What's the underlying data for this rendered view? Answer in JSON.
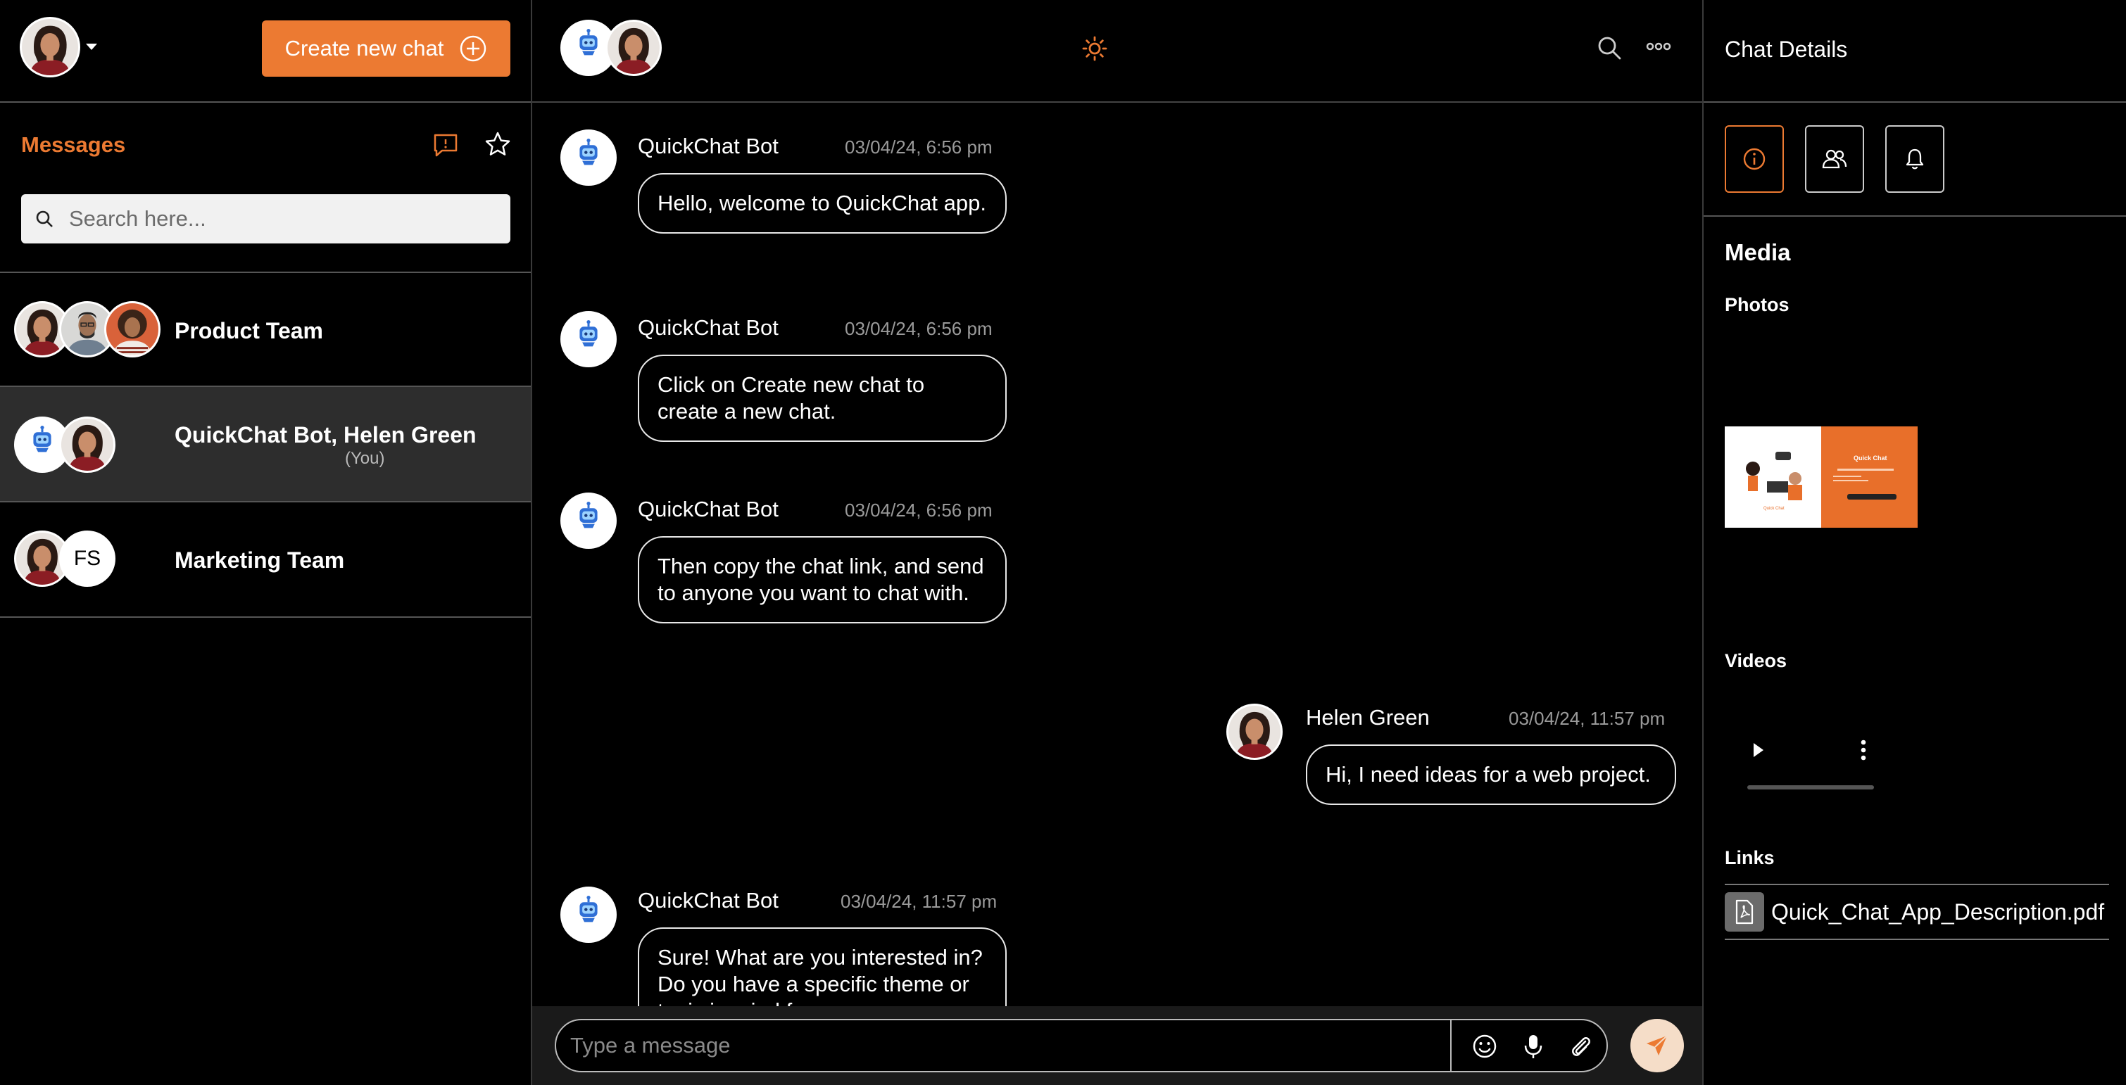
{
  "sidebar": {
    "create_button_label": "Create new chat",
    "messages_title": "Messages",
    "search_placeholder": "Search here...",
    "chats": [
      {
        "name": "Product Team"
      },
      {
        "name": "QuickChat Bot, Helen Green",
        "sub": "(You)"
      },
      {
        "name": "Marketing Team",
        "initials": "FS"
      }
    ]
  },
  "conversation": {
    "messages": [
      {
        "sender": "QuickChat Bot",
        "time": "03/04/24, 6:56 pm",
        "text": "Hello, welcome to QuickChat app."
      },
      {
        "sender": "QuickChat Bot",
        "time": "03/04/24, 6:56 pm",
        "text": "Click on Create new chat to create a new chat."
      },
      {
        "sender": "QuickChat Bot",
        "time": "03/04/24, 6:56 pm",
        "text": "Then copy the chat link, and send to anyone you want to chat with."
      },
      {
        "sender": "Helen Green",
        "time": "03/04/24, 11:57 pm",
        "text": "Hi, I need ideas for a web project."
      },
      {
        "sender": "QuickChat Bot",
        "time": "03/04/24, 11:57 pm",
        "text": "Sure! What are you interested in? Do you have a specific theme or topic in mind for your"
      }
    ],
    "bot_avatar_text": "CHAT BOT",
    "composer_placeholder": "Type a message"
  },
  "details": {
    "title": "Chat Details",
    "media_title": "Media",
    "photos_title": "Photos",
    "photo_thumb_title": "Quick Chat",
    "photo_thumb_caption": "Quick Chat",
    "videos_title": "Videos",
    "links_title": "Links",
    "link_file": "Quick_Chat_App_Description.pdf"
  },
  "colors": {
    "accent": "#ec7a32",
    "background": "#000000",
    "selected_row": "#2d2d2d"
  }
}
